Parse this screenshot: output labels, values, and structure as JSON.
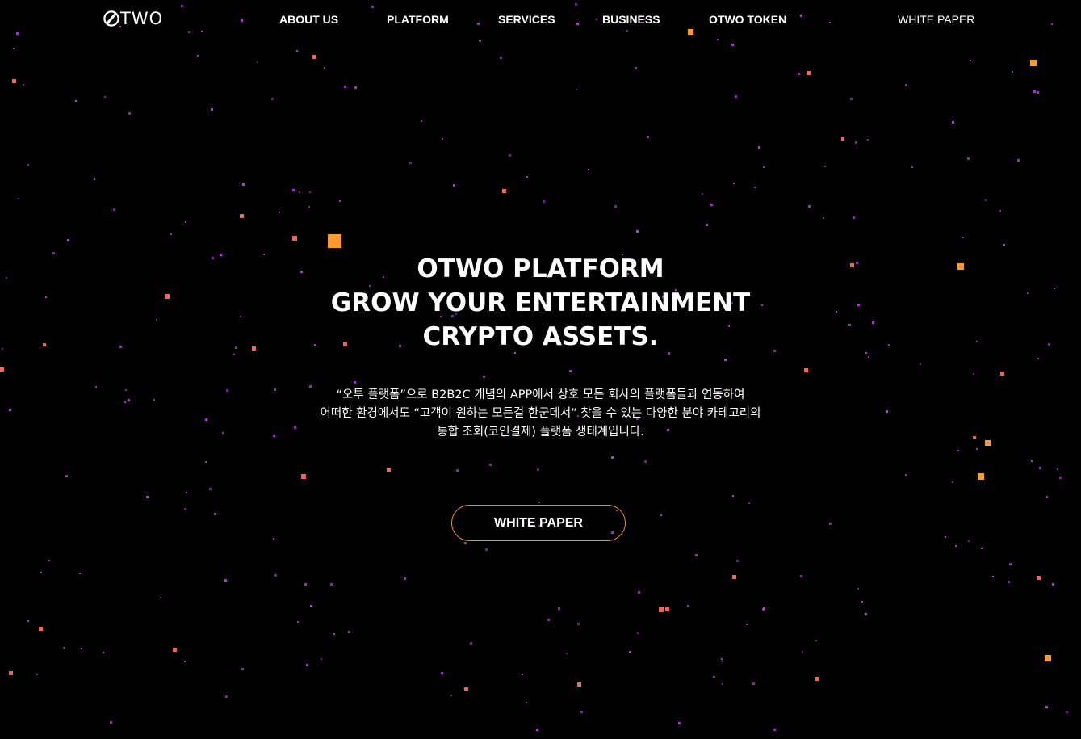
{
  "brand": {
    "logo_text": "TWO",
    "accent_color": "#e88a2c"
  },
  "nav": {
    "about": "ABOUT US",
    "platform": "PLATFORM",
    "services": "SERVICES",
    "business": "BUSINESS",
    "token": "OTWO TOKEN",
    "white_paper": "WHITE PAPER"
  },
  "hero": {
    "title_lines": [
      "OTWO PLATFORM",
      "GROW YOUR ENTERTAINMENT",
      "CRYPTO ASSETS."
    ],
    "description_lines": [
      "“오투 플랫폼”으로 B2B2C 개념의 APP에서 상호 모든 회사의 플랫폼들과 연동하여",
      "어떠한 환경에서도 “고객이 원하는 모든걸 한군데서” 찾을 수 있는 다양한 분야 카테고리의",
      "통합 조회(코인결제) 플랫폼 생태계입니다."
    ],
    "cta_label": "WHITE PAPER"
  },
  "background": {
    "color": "#000000",
    "particle_colors": [
      "#ff9a2e",
      "#f0665a",
      "#b33fd6"
    ]
  }
}
